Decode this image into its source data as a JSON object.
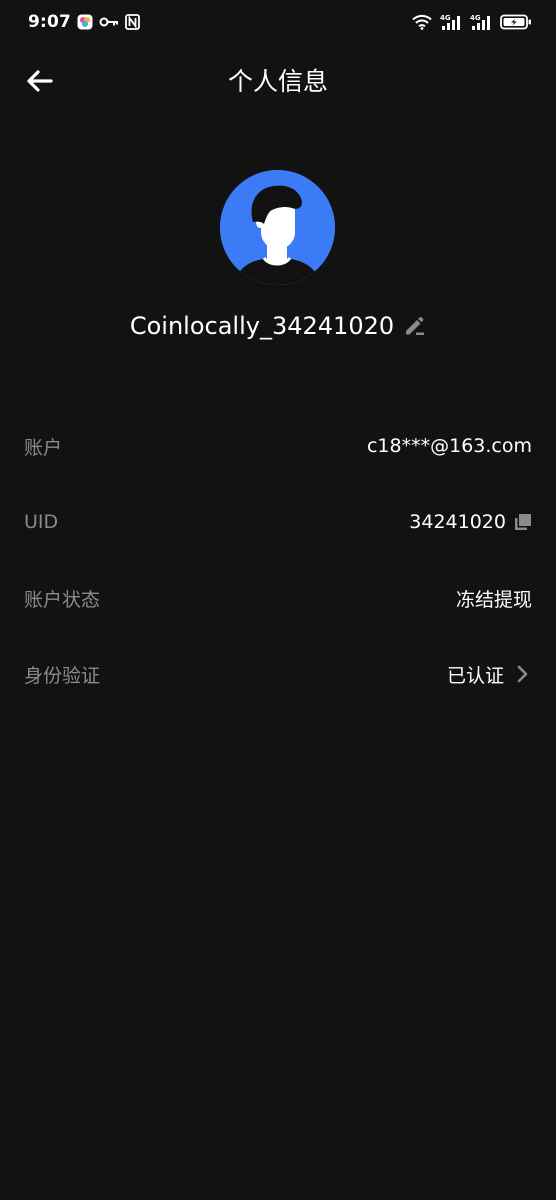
{
  "status_bar": {
    "time": "9:07",
    "left_icons": [
      "app-icon",
      "key-icon",
      "nfc-icon"
    ],
    "right_icons": [
      "wifi-icon",
      "signal-4g-icon",
      "signal-4g-icon",
      "battery-charging-icon"
    ],
    "network_1": "4G",
    "network_2": "4G"
  },
  "header": {
    "title": "个人信息",
    "back_icon": "arrow-left-icon"
  },
  "profile": {
    "avatar_color": "#3B7BF6",
    "username": "Coinlocally_34241020",
    "edit_icon": "edit-pencil-icon"
  },
  "info": {
    "account": {
      "label": "账户",
      "value": "c18***@163.com"
    },
    "uid": {
      "label": "UID",
      "value": "34241020",
      "action_icon": "copy-icon"
    },
    "status": {
      "label": "账户状态",
      "value": "冻结提现"
    },
    "verification": {
      "label": "身份验证",
      "value": "已认证",
      "action_icon": "chevron-right-icon"
    }
  },
  "colors": {
    "background": "#121212",
    "text_primary": "#FFFFFF",
    "text_secondary": "#8A8A8A",
    "accent": "#3B7BF6"
  }
}
